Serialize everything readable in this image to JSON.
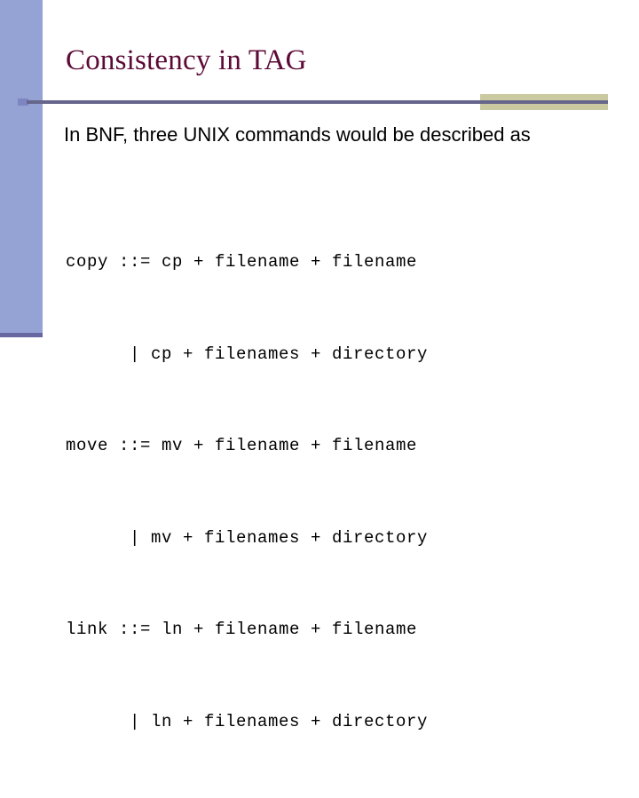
{
  "slide": {
    "title": "Consistency in TAG",
    "body_paragraph": "In BNF, three UNIX commands would be described as",
    "code_lines": [
      "copy ::= cp + filename + filename",
      "      | cp + filenames + directory",
      "move ::= mv + filename + filename",
      "      | mv + filenames + directory",
      "link ::= ln + filename + filename",
      "      | ln + filenames + directory"
    ]
  },
  "colors": {
    "title": "#5c0a36",
    "sidebar": "#94a2d4",
    "sidebar_foot": "#6667a0",
    "rule_line": "#66668c",
    "rule_khaki": "#c9caa0",
    "background": "#ffffff",
    "text": "#000000"
  }
}
